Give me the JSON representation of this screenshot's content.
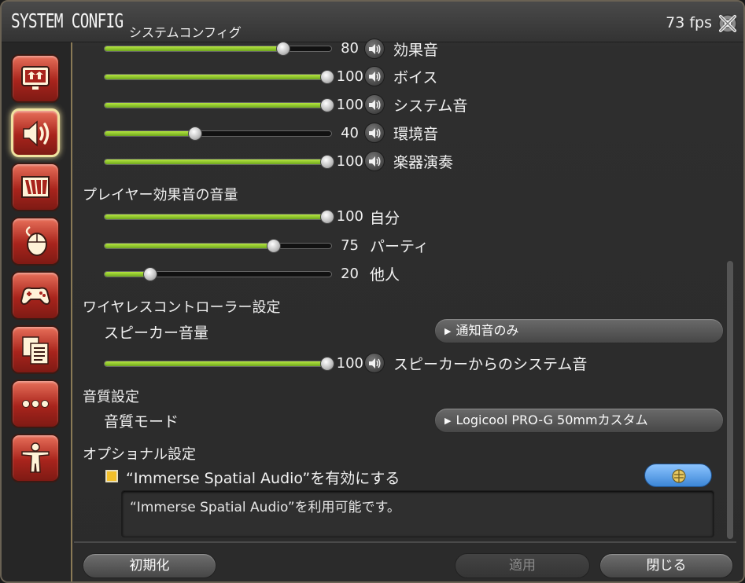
{
  "titlebar": {
    "title": "SYSTEM CONFIG",
    "subtitle": "システムコンフィグ",
    "fps": "73 fps"
  },
  "sidebar": {
    "items": [
      {
        "icon": "display-settings-icon",
        "active": false
      },
      {
        "icon": "sound-settings-icon",
        "active": true
      },
      {
        "icon": "theme-settings-icon",
        "active": false
      },
      {
        "icon": "mouse-settings-icon",
        "active": false
      },
      {
        "icon": "gamepad-settings-icon",
        "active": false
      },
      {
        "icon": "other-settings-icon",
        "active": false
      },
      {
        "icon": "more-settings-icon",
        "active": false
      },
      {
        "icon": "accessibility-settings-icon",
        "active": false
      }
    ]
  },
  "volume_sliders": [
    {
      "label": "効果音",
      "value": 80,
      "speaker": true
    },
    {
      "label": "ボイス",
      "value": 100,
      "speaker": true
    },
    {
      "label": "システム音",
      "value": 100,
      "speaker": true
    },
    {
      "label": "環境音",
      "value": 40,
      "speaker": true
    },
    {
      "label": "楽器演奏",
      "value": 100,
      "speaker": true
    }
  ],
  "player_effects": {
    "heading": "プレイヤー効果音の音量",
    "sliders": [
      {
        "label": "自分",
        "value": 100
      },
      {
        "label": "パーティ",
        "value": 75
      },
      {
        "label": "他人",
        "value": 20
      }
    ]
  },
  "wireless": {
    "heading": "ワイヤレスコントローラー設定",
    "speaker_volume_label": "スピーカー音量",
    "speaker_volume_value": "通知音のみ",
    "slider": {
      "label": "スピーカーからのシステム音",
      "value": 100
    }
  },
  "quality": {
    "heading": "音質設定",
    "mode_label": "音質モード",
    "mode_value": "Logicool PRO-G 50mmカスタム"
  },
  "optional": {
    "heading": "オプショナル設定",
    "checkbox_label": "“Immerse Spatial Audio”を有効にする",
    "checked": true,
    "description": "“Immerse Spatial Audio”を利用可能です。"
  },
  "footer": {
    "reset_label": "初期化",
    "apply_label": "適用",
    "close_label": "閉じる"
  },
  "colors": {
    "slider_fill": "#9ccf30",
    "checkbox": "#f3c02a",
    "active_border": "#f0e2a0",
    "category_red": "#a8241c",
    "blue_button": "#4a90e0"
  }
}
